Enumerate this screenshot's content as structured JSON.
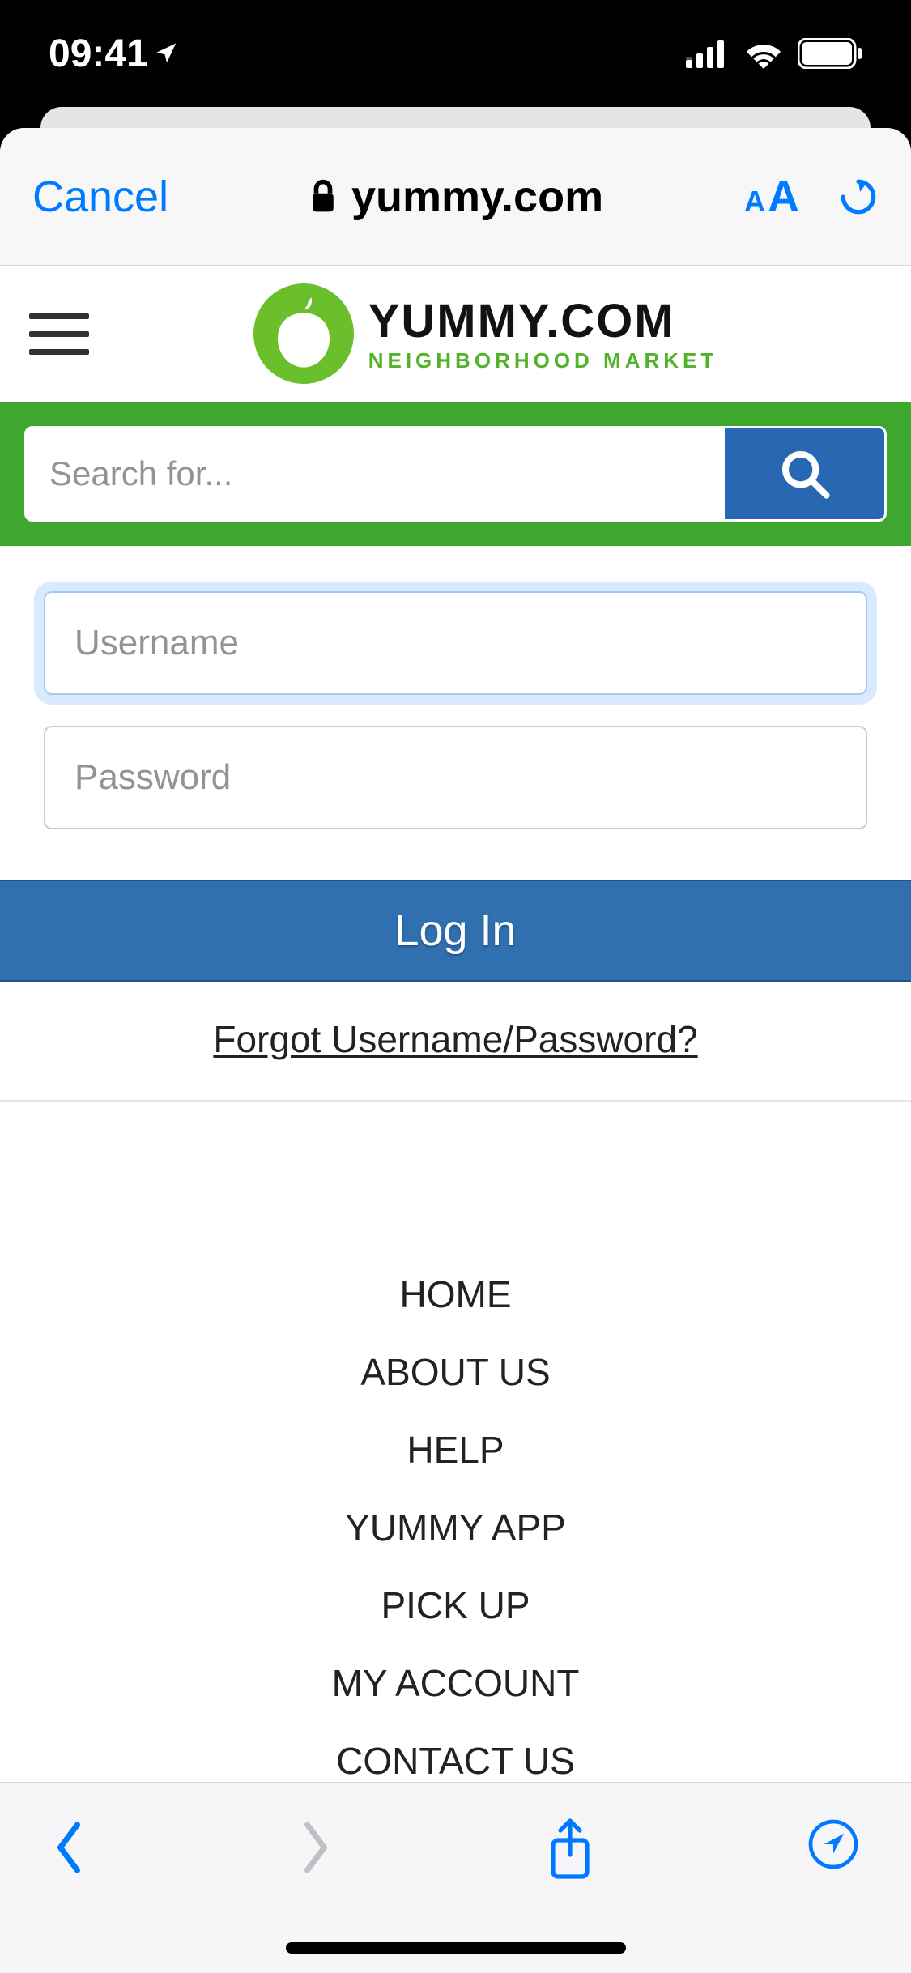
{
  "statusbar": {
    "time": "09:41"
  },
  "addressbar": {
    "cancel": "Cancel",
    "domain": "yummy.com"
  },
  "header": {
    "logo_title": "YUMMY.COM",
    "logo_sub": "NEIGHBORHOOD MARKET"
  },
  "search": {
    "placeholder": "Search for..."
  },
  "login": {
    "username_placeholder": "Username",
    "password_placeholder": "Password",
    "button": "Log In",
    "forgot": "Forgot Username/Password?"
  },
  "footer": {
    "links": [
      "HOME",
      "ABOUT US",
      "HELP",
      "YUMMY APP",
      "PICK UP",
      "MY ACCOUNT",
      "CONTACT US"
    ]
  },
  "colors": {
    "ios_blue": "#007aff",
    "brand_green": "#3da72e",
    "button_blue": "#3070b0",
    "search_button_blue": "#2868b3"
  }
}
